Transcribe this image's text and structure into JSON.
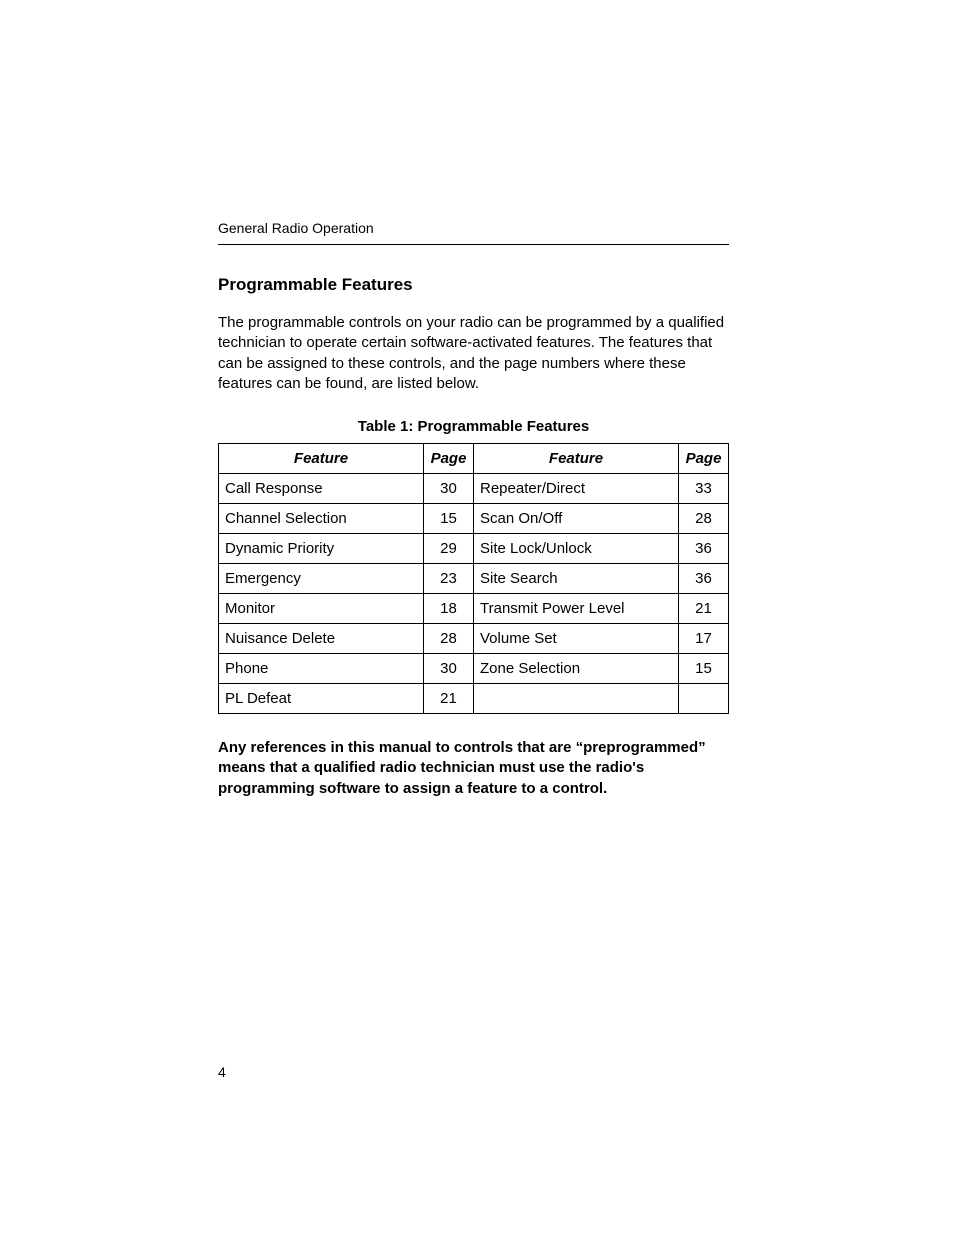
{
  "header": {
    "running": "General Radio Operation"
  },
  "section": {
    "heading": "Programmable Features",
    "intro": "The programmable controls on your radio can be programmed by a qualified technician to operate certain software-activated features. The features that can be assigned to these controls, and the page numbers where these features can be found, are listed below.",
    "tableCaption": "Table 1: Programmable Features",
    "note": "Any references in this manual to controls that are “preprogrammed” means that a qualified radio technician must use the radio's programming software to assign a feature to a control."
  },
  "table": {
    "headers": {
      "feature": "Feature",
      "page": "Page"
    },
    "rows": [
      {
        "f1": "Call Response",
        "p1": "30",
        "f2": "Repeater/Direct",
        "p2": "33"
      },
      {
        "f1": "Channel Selection",
        "p1": "15",
        "f2": "Scan On/Off",
        "p2": "28"
      },
      {
        "f1": "Dynamic Priority",
        "p1": "29",
        "f2": "Site Lock/Unlock",
        "p2": "36"
      },
      {
        "f1": "Emergency",
        "p1": "23",
        "f2": "Site Search",
        "p2": "36"
      },
      {
        "f1": "Monitor",
        "p1": "18",
        "f2": "Transmit Power Level",
        "p2": "21"
      },
      {
        "f1": "Nuisance Delete",
        "p1": "28",
        "f2": "Volume Set",
        "p2": "17"
      },
      {
        "f1": "Phone",
        "p1": "30",
        "f2": "Zone Selection",
        "p2": "15"
      },
      {
        "f1": "PL Defeat",
        "p1": "21",
        "f2": "",
        "p2": ""
      }
    ]
  },
  "footer": {
    "pageNumber": "4"
  }
}
